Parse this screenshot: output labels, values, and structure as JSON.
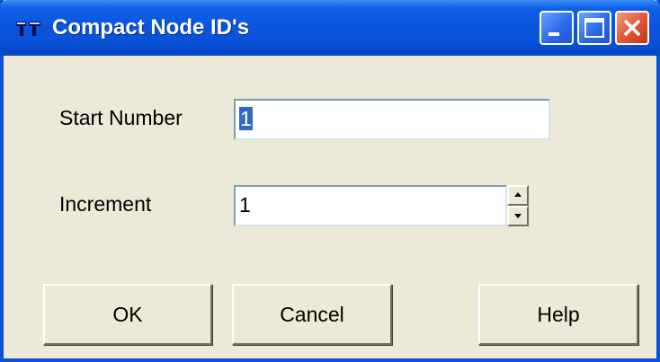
{
  "window": {
    "title": "Compact Node ID's",
    "icon": "app-icon",
    "controls": [
      "minimize-icon",
      "maximize-icon",
      "close-icon"
    ]
  },
  "form": {
    "start_number": {
      "label": "Start Number",
      "value": "1",
      "selected": true
    },
    "increment": {
      "label": "Increment",
      "value": "1"
    }
  },
  "buttons": {
    "ok": "OK",
    "cancel": "Cancel",
    "help": "Help"
  },
  "colors": {
    "titlebar": "#0a55df",
    "dialog_bg": "#ece9d8",
    "selection": "#316ac5",
    "close_button": "#e2583a"
  }
}
